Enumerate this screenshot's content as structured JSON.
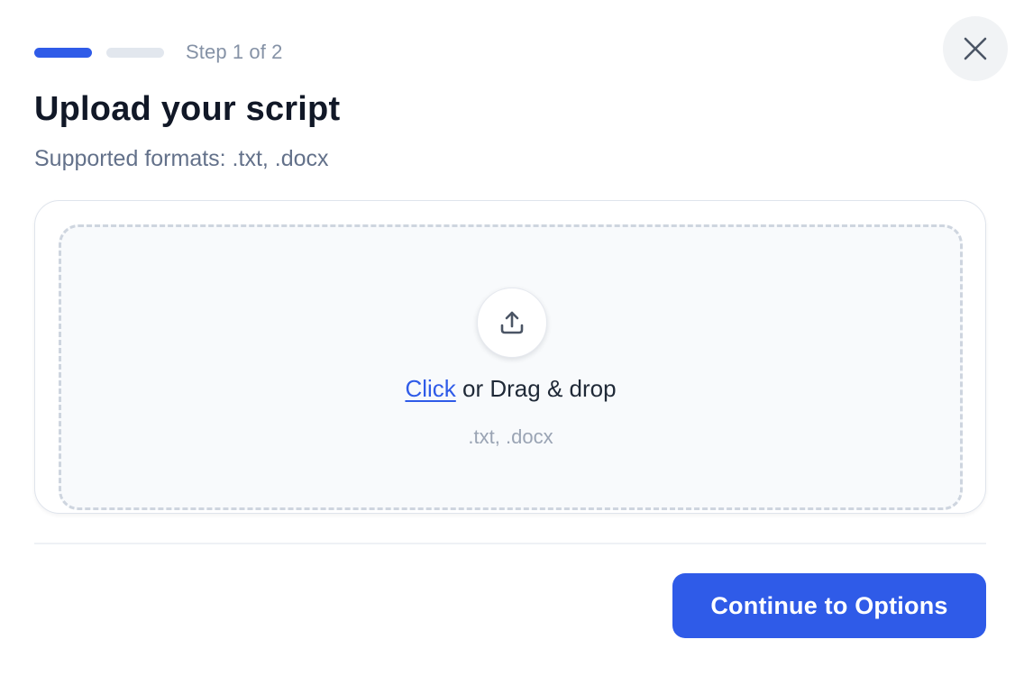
{
  "progress": {
    "total_steps": 2,
    "current_step": 1,
    "step_label": "Step 1 of 2",
    "active_color": "#2f5be8",
    "inactive_color": "#e2e7ee"
  },
  "header": {
    "title": "Upload your script",
    "subtitle": "Supported formats: .txt, .docx",
    "close_icon": "close-icon"
  },
  "dropzone": {
    "icon": "upload-icon",
    "link_text": "Click",
    "rest_text": " or Drag & drop",
    "formats": ".txt, .docx"
  },
  "footer": {
    "continue_label": "Continue to Options",
    "button_color": "#2f5be8"
  }
}
